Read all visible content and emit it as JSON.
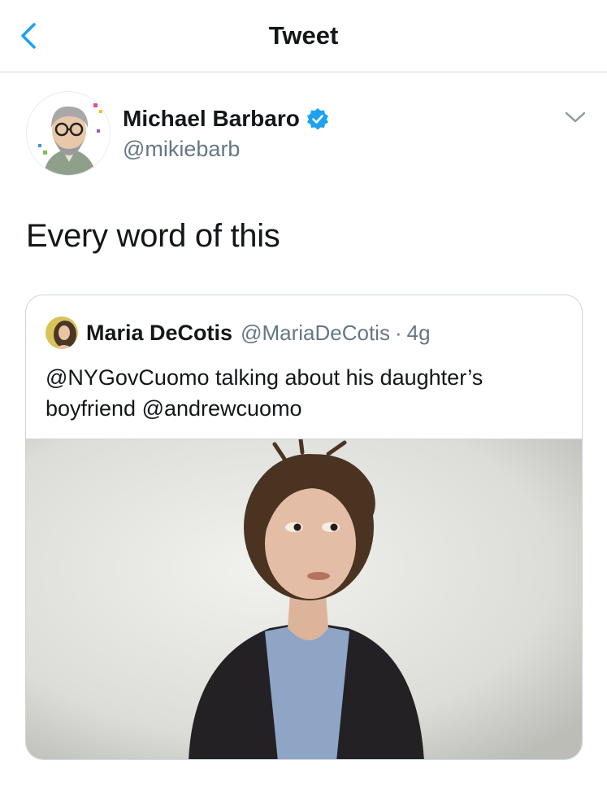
{
  "header": {
    "title": "Tweet"
  },
  "tweet": {
    "author": {
      "name": "Michael Barbaro",
      "handle": "@mikiebarb"
    },
    "text": "Every word of this"
  },
  "quoted": {
    "author": {
      "name": "Maria DeCotis",
      "handle": "@MariaDeCotis",
      "time": "4g"
    },
    "separator": "·",
    "text": "@NYGovCuomo talking about his daughter’s boyfriend @andrewcuomo"
  },
  "colors": {
    "link_blue": "#1da1f2",
    "secondary_text": "#657786",
    "border": "#ccd6dd"
  }
}
